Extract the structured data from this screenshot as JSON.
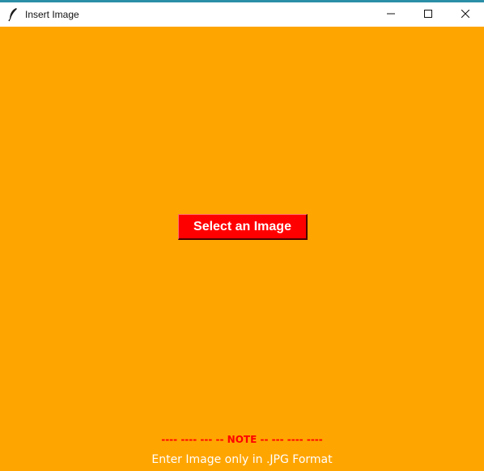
{
  "window": {
    "title": "Insert Image",
    "icon": "feather-icon",
    "controls": [
      "minimize-icon",
      "maximize-icon",
      "close-icon"
    ]
  },
  "main": {
    "select_button_label": "Select an Image",
    "note_text": "---- ---- --- -- NOTE -- --- ---- ----",
    "format_text": "Enter Image only in .JPG Format"
  },
  "colors": {
    "background": "#ffa500",
    "button_background": "#ff0000",
    "button_text": "#ffffff",
    "note_text": "#ff0000",
    "format_text": "#ffffff"
  }
}
